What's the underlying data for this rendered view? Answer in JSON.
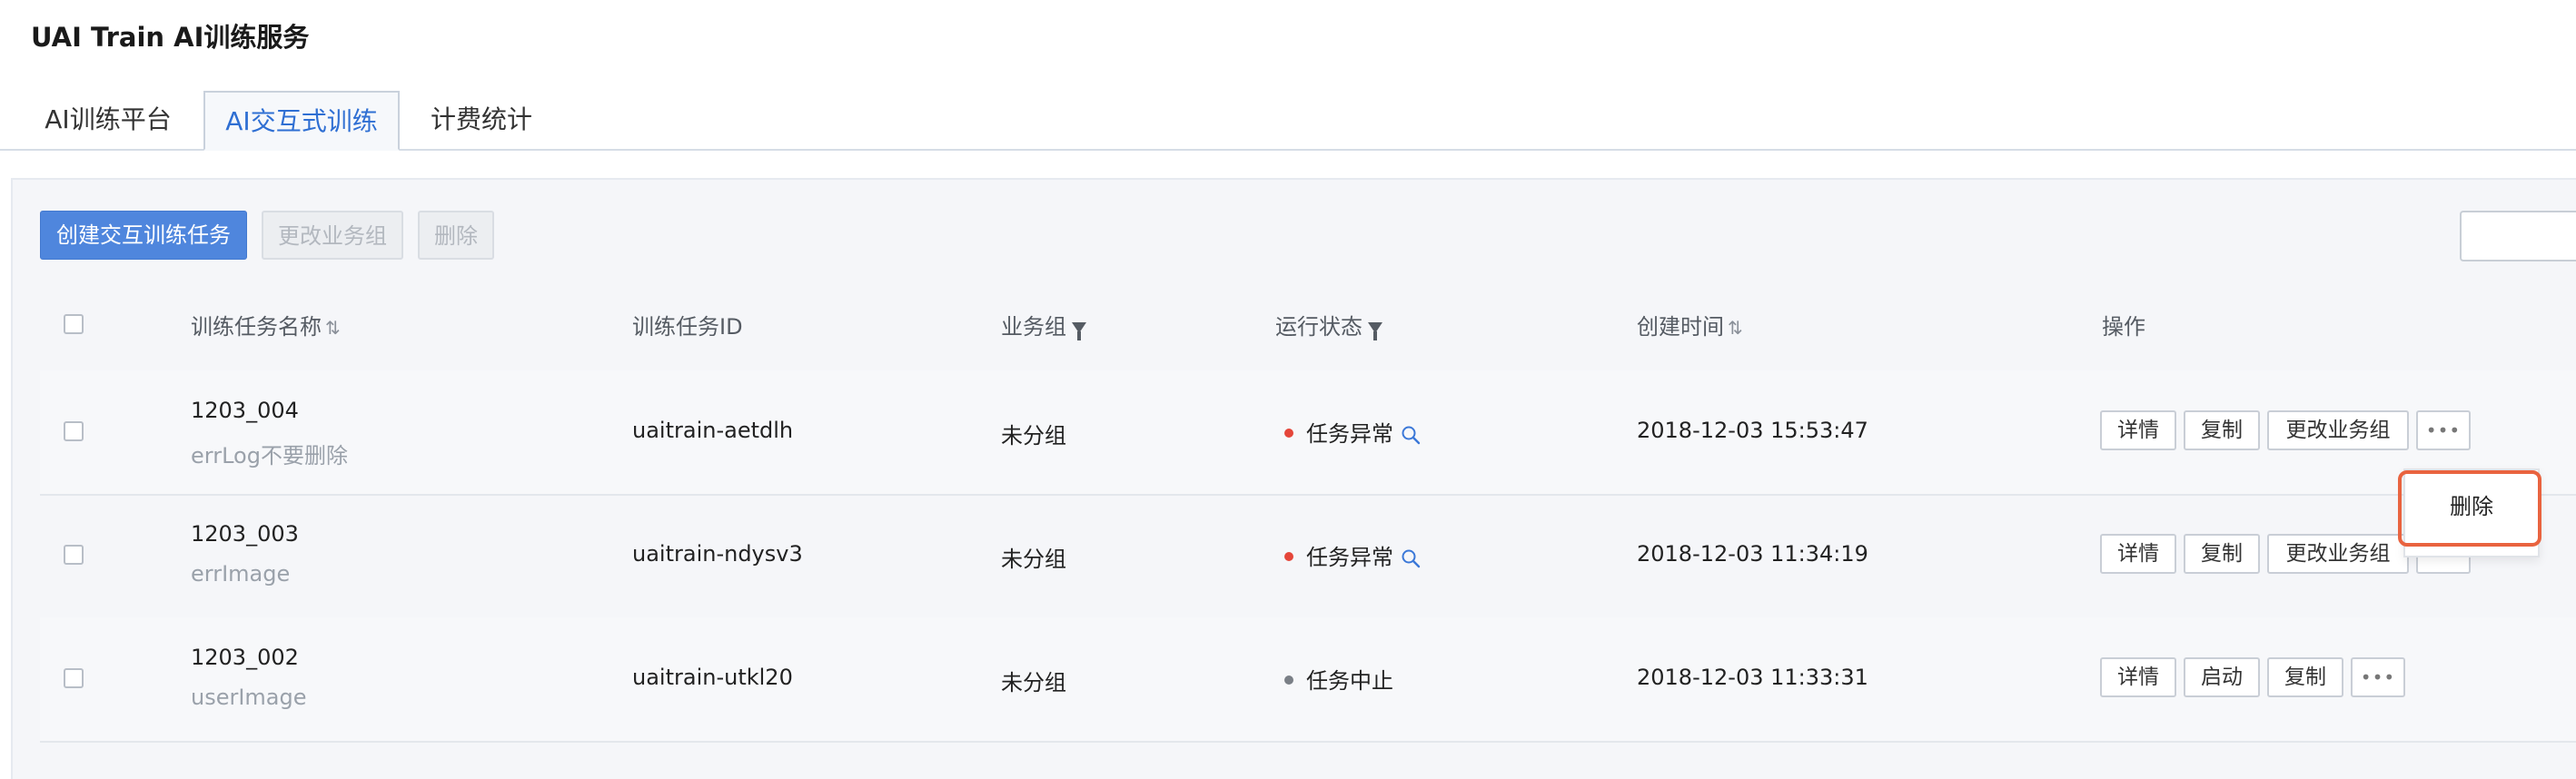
{
  "page": {
    "title": "UAI Train AI训练服务"
  },
  "tabs": [
    {
      "label": "AI训练平台"
    },
    {
      "label": "AI交互式训练"
    },
    {
      "label": "计费统计"
    }
  ],
  "toolbar": {
    "create_label": "创建交互训练任务",
    "change_group_label": "更改业务组",
    "delete_label": "删除"
  },
  "table": {
    "headers": {
      "name": "训练任务名称",
      "id": "训练任务ID",
      "group": "业务组",
      "status": "运行状态",
      "created": "创建时间",
      "ops": "操作"
    },
    "sort_glyph": "⇅",
    "rows": [
      {
        "name": "1203_004",
        "desc": "errLog不要删除",
        "id": "uaitrain-aetdlh",
        "group": "未分组",
        "status": "任务异常",
        "status_color": "#e5463a",
        "created": "2018-12-03 15:53:47",
        "ops": [
          "详情",
          "复制",
          "更改业务组"
        ],
        "more": "•••"
      },
      {
        "name": "1203_003",
        "desc": "errImage",
        "id": "uaitrain-ndysv3",
        "group": "未分组",
        "status": "任务异常",
        "status_color": "#e5463a",
        "created": "2018-12-03 11:34:19",
        "ops": [
          "详情",
          "复制",
          "更改业务组"
        ],
        "more": "•••"
      },
      {
        "name": "1203_002",
        "desc": "userImage",
        "id": "uaitrain-utkl20",
        "group": "未分组",
        "status": "任务中止",
        "status_color": "#7a7f86",
        "created": "2018-12-03 11:33:31",
        "ops": [
          "详情",
          "启动",
          "复制"
        ],
        "more": "•••"
      }
    ]
  },
  "dropdown": {
    "items": [
      {
        "label": "删除"
      }
    ]
  },
  "colors": {
    "accent": "#4f86dd",
    "error": "#e5463a",
    "highlight": "#e9633f"
  },
  "icons": {
    "status_search": "search-icon",
    "sort": "sort-icon",
    "filter": "filter-icon",
    "more": "more-icon"
  }
}
